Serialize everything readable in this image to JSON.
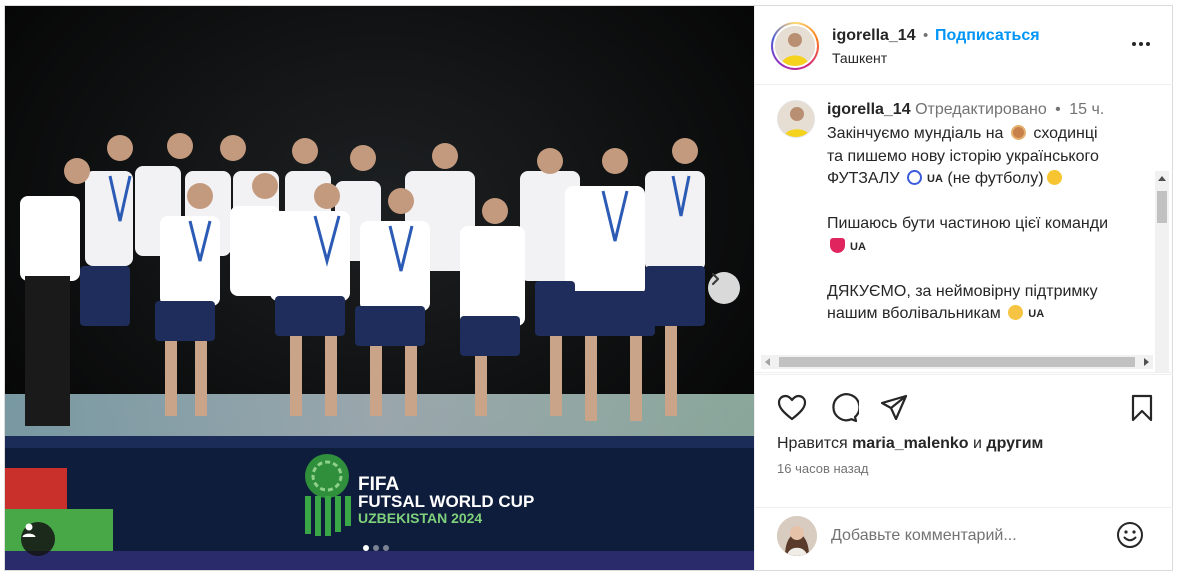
{
  "post": {
    "username": "igorella_14",
    "separator": "•",
    "follow_label": "Подписаться",
    "location": "Ташкент"
  },
  "caption": {
    "username": "igorella_14",
    "edited_label": "Отредактировано",
    "separator": "•",
    "time": "15 ч.",
    "line1a": "Закінчуємо мундіаль на",
    "line1b": "сходинці",
    "line2": "та пишемо нову історію українського",
    "line3a": "ФУТЗАЛУ",
    "line3b": "(не футболу)",
    "para2": "Пишаюсь бути частиною цієї команди",
    "para3a": "ДЯКУЄМО, за неймовірну підтримку",
    "para3b": "нашим вболівальникам",
    "flag": "UA"
  },
  "media": {
    "banner_line1": "FIFA",
    "banner_line2": "FUTSAL WORLD CUP",
    "banner_line3": "UZBEKISTAN 2024",
    "carousel_total": 3,
    "carousel_active": 1
  },
  "engagement": {
    "likes_prefix": "Нравится",
    "liker": "maria_malenko",
    "likes_and": "и",
    "likes_others": "другим",
    "time_ago": "16 часов назад"
  },
  "comment": {
    "placeholder": "Добавьте комментарий..."
  },
  "icons": {
    "like": "heart-icon",
    "comment": "comment-icon",
    "share": "paper-plane-icon",
    "save": "bookmark-icon",
    "more": "more-dots-icon",
    "next": "chevron-right-icon",
    "tag": "user-tag-icon",
    "emoji": "smiley-icon"
  },
  "colors": {
    "follow": "#0095f6",
    "muted": "#737373",
    "text": "#262626"
  }
}
